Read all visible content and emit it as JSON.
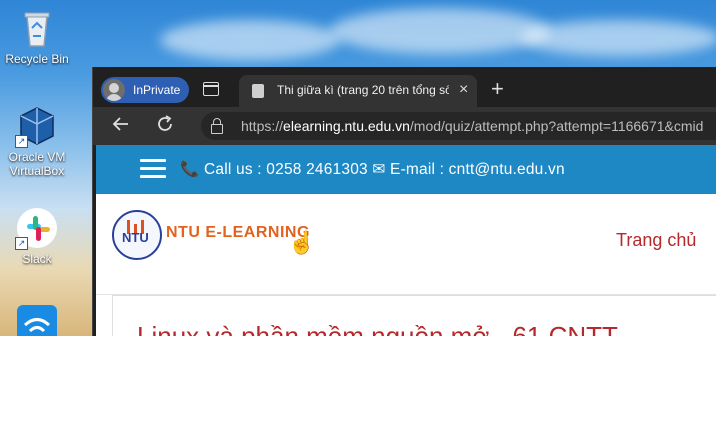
{
  "desktop": {
    "icons": [
      {
        "label": "Recycle Bin",
        "icon": "recycle-bin-icon"
      },
      {
        "label": "Oracle VM VirtualBox",
        "icon": "virtualbox-icon"
      },
      {
        "label": "Slack",
        "icon": "slack-icon"
      },
      {
        "label": "",
        "icon": "wifi-app-icon"
      }
    ]
  },
  "browser": {
    "profile_label": "InPrivate",
    "tab": {
      "title": "Thi giữa kì (trang 20 trên tổng số"
    },
    "address": {
      "prefix": "https://",
      "domain": "elearning.ntu.edu.vn",
      "path": "/mod/quiz/attempt.php?attempt=1166671&cmid"
    }
  },
  "site": {
    "topbar": {
      "contact": "📞 Call us : 0258 2461303 ✉ E-mail : cntt@ntu.edu.vn"
    },
    "logo": {
      "mark": "NTU",
      "text": "NTU E-LEARNING"
    },
    "nav": {
      "home": "Trang chủ"
    },
    "course_title": "Linux và phần mềm nguồn mở - 61.CNTT"
  },
  "colors": {
    "topbar": "#1e88c5",
    "title_red": "#b5282b",
    "logo_orange": "#e0641f",
    "inprivate": "#2f5fb3"
  }
}
